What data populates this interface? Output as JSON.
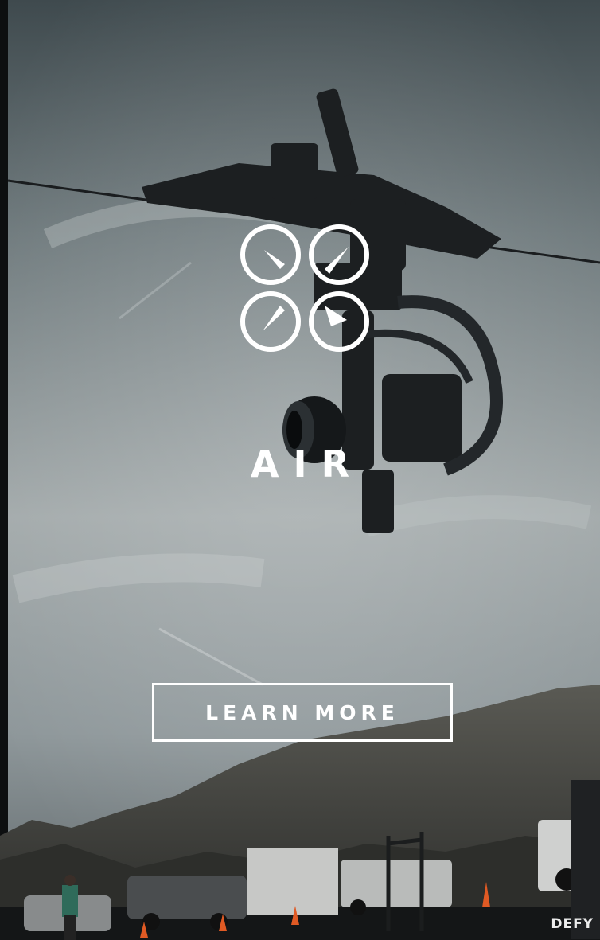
{
  "hero": {
    "title": "AIR",
    "cta_label": "LEARN MORE",
    "watermark": "DEFY",
    "logo_icon": "four-rotor-dial-icon"
  },
  "colors": {
    "sky_top": "#4a5356",
    "sky_mid": "#a6adaf",
    "mountain": "#3b3d3a",
    "ground": "#141617",
    "text": "#ffffff"
  }
}
